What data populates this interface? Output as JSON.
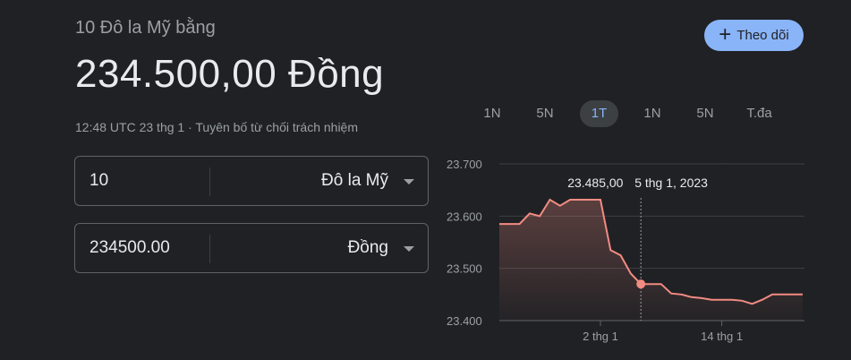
{
  "converter": {
    "subtitle": "10 Đô la Mỹ bằng",
    "result": "234.500,00 Đồng",
    "timestamp": "12:48 UTC 23 thg 1",
    "separator": " · ",
    "disclaimer": "Tuyên bố từ chối trách nhiệm",
    "follow_label": "Theo dõi",
    "from": {
      "value": "10",
      "unit": "Đô la Mỹ"
    },
    "to": {
      "value": "234500.00",
      "unit": "Đồng"
    }
  },
  "range_tabs": [
    {
      "label": "1N",
      "active": false
    },
    {
      "label": "5N",
      "active": false
    },
    {
      "label": "1T",
      "active": true
    },
    {
      "label": "1N",
      "active": false
    },
    {
      "label": "5N",
      "active": false
    },
    {
      "label": "T.đa",
      "active": false
    }
  ],
  "tooltip": {
    "value": "23.485,00",
    "date": "5 thg 1, 2023"
  },
  "colors": {
    "line": "#f28b82",
    "accent": "#8ab4f8"
  },
  "chart_data": {
    "type": "line",
    "ylim": [
      23400,
      23700
    ],
    "y_ticks": [
      23700,
      23600,
      23500,
      23400
    ],
    "y_tick_labels": [
      "23.700",
      "23.600",
      "23.500",
      "23.400"
    ],
    "x_ticks": [
      {
        "day": 11,
        "label": "2 thg 1"
      },
      {
        "day": 23,
        "label": "14 thg 1"
      }
    ],
    "x": [
      1,
      2,
      3,
      4,
      5,
      6,
      7,
      8,
      9,
      10,
      11,
      12,
      13,
      14,
      15,
      16,
      17,
      18,
      19,
      20,
      21,
      22,
      23,
      24,
      25,
      26,
      27,
      28,
      29,
      30,
      31
    ],
    "values": [
      23585,
      23585,
      23585,
      23605,
      23600,
      23635,
      23620,
      23635,
      23640,
      23640,
      23640,
      23535,
      23525,
      23490,
      23470,
      23470,
      23470,
      23452,
      23450,
      23445,
      23443,
      23440,
      23440,
      23440,
      23438,
      23432,
      23440,
      23450,
      23450,
      23450,
      23450
    ],
    "highlight_index": 14
  }
}
